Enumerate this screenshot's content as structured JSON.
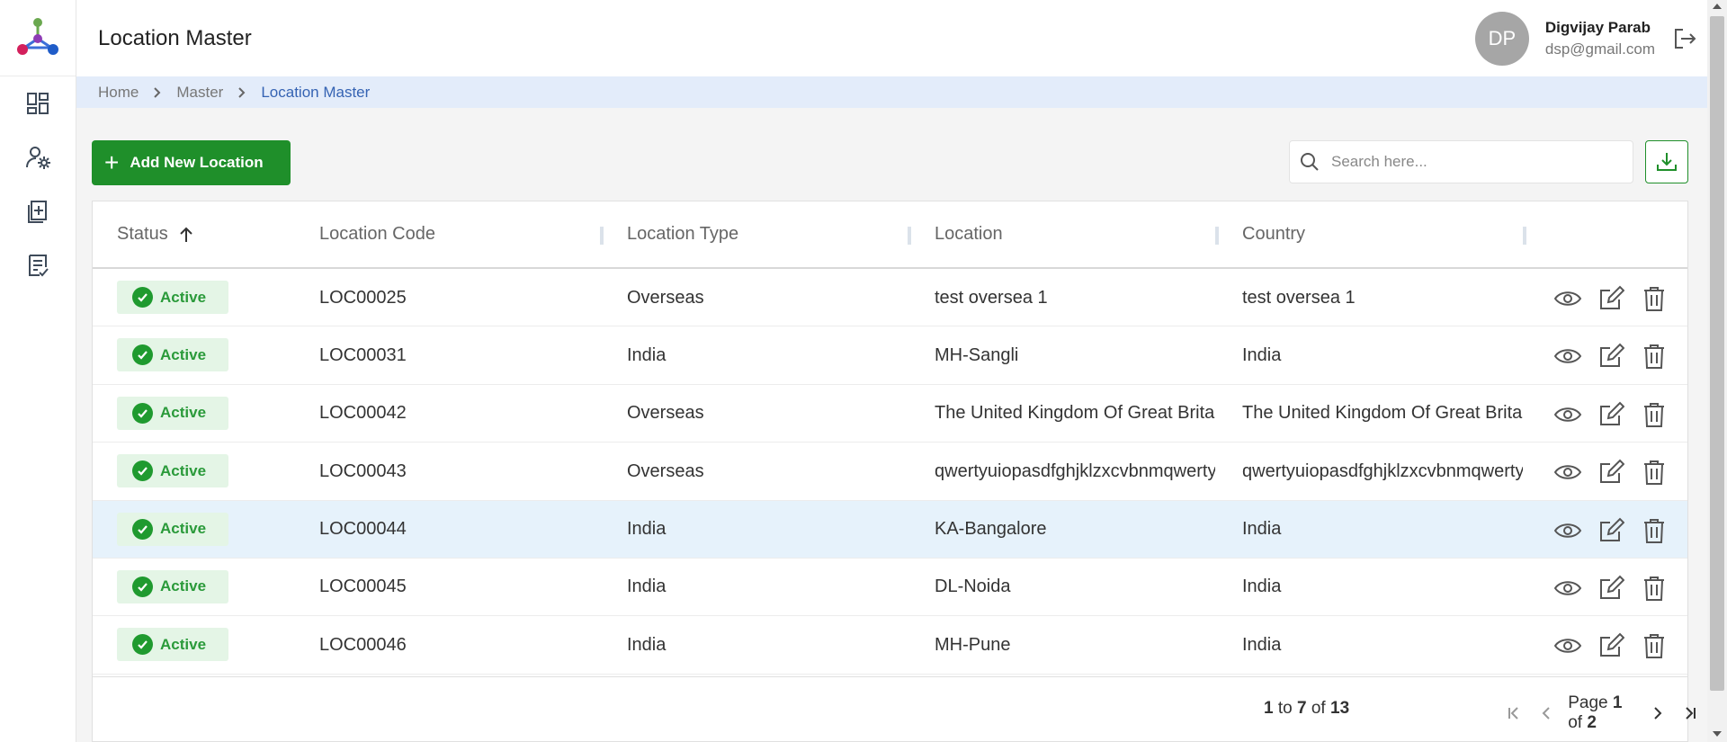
{
  "header": {
    "title": "Location Master",
    "user_initials": "DP",
    "user_name": "Digvijay Parab",
    "user_email": "dsp@gmail.com"
  },
  "breadcrumb": [
    "Home",
    "Master",
    "Location Master"
  ],
  "toolbar": {
    "add_label": "Add New Location",
    "search_placeholder": "Search here..."
  },
  "columns": [
    "Status",
    "Location Code",
    "Location Type",
    "Location",
    "Country"
  ],
  "rows": [
    {
      "status": "Active",
      "code": "LOC00025",
      "type": "Overseas",
      "location": "test oversea 1",
      "country": "test oversea 1"
    },
    {
      "status": "Active",
      "code": "LOC00031",
      "type": "India",
      "location": "MH-Sangli",
      "country": "India"
    },
    {
      "status": "Active",
      "code": "LOC00042",
      "type": "Overseas",
      "location": "The United Kingdom Of Great Britain",
      "country": "The United Kingdom Of Great Britain"
    },
    {
      "status": "Active",
      "code": "LOC00043",
      "type": "Overseas",
      "location": "qwertyuiopasdfghjklzxcvbnmqwerty",
      "country": "qwertyuiopasdfghjklzxcvbnmqwerty"
    },
    {
      "status": "Active",
      "code": "LOC00044",
      "type": "India",
      "location": "KA-Bangalore",
      "country": "India"
    },
    {
      "status": "Active",
      "code": "LOC00045",
      "type": "India",
      "location": "DL-Noida",
      "country": "India"
    },
    {
      "status": "Active",
      "code": "LOC00046",
      "type": "India",
      "location": "MH-Pune",
      "country": "India"
    }
  ],
  "selected_row": 4,
  "footer": {
    "range_from": "1",
    "range_to": "7",
    "total": "13",
    "to_label": "to",
    "of_label": "of",
    "page_label": "Page",
    "page_current": "1",
    "page_total": "2"
  },
  "colors": {
    "accent_green": "#1f8f2a",
    "breadcrumb_bg": "#e3ecfa",
    "breadcrumb_current": "#3563b3",
    "selected_row_bg": "#e6f2fb"
  },
  "icons": {
    "sidebar": [
      "dashboard-icon",
      "user-settings-icon",
      "add-document-icon",
      "checklist-icon"
    ],
    "row_actions": [
      "view-icon",
      "edit-icon",
      "delete-icon"
    ]
  }
}
